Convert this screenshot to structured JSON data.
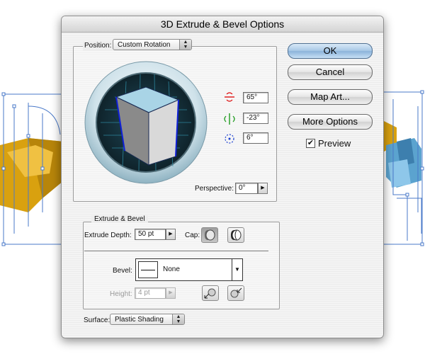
{
  "dialog": {
    "title": "3D Extrude & Bevel Options"
  },
  "position": {
    "label": "Position:",
    "mode": "Custom Rotation",
    "rotation_x": "65°",
    "rotation_y": "-23°",
    "rotation_z": "6°",
    "perspective_label": "Perspective:",
    "perspective_value": "0°"
  },
  "extrude_bevel": {
    "group_label": "Extrude & Bevel",
    "depth_label": "Extrude Depth:",
    "depth_value": "50 pt",
    "cap_label": "Cap:",
    "bevel_label": "Bevel:",
    "bevel_value": "None",
    "height_label": "Height:",
    "height_value": "4 pt"
  },
  "surface": {
    "label": "Surface:",
    "value": "Plastic Shading"
  },
  "buttons": {
    "ok": "OK",
    "cancel": "Cancel",
    "map_art": "Map Art...",
    "more_options": "More Options"
  },
  "preview": {
    "label": "Preview",
    "checked_mark": "✔"
  },
  "colors": {
    "accent": "#8cb3da",
    "artwork_gold": "#d9a10f",
    "artwork_blue": "#5ba3cf",
    "selection": "#4a79c9"
  }
}
